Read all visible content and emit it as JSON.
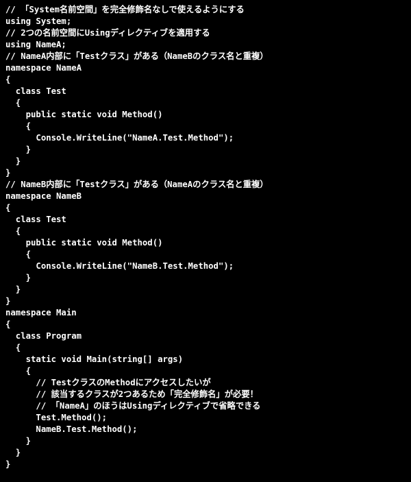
{
  "code": {
    "lines": [
      "// 「System名前空間」を完全修飾名なしで使えるようにする",
      "using System;",
      "",
      "// 2つの名前空間にUsingディレクティブを適用する",
      "using NameA;",
      "",
      "// NameA内部に「Testクラス」がある（NameBのクラス名と重複）",
      "namespace NameA",
      "{",
      "  class Test",
      "  {",
      "    public static void Method()",
      "    {",
      "      Console.WriteLine(\"NameA.Test.Method\");",
      "    }",
      "  }",
      "}",
      "",
      "// NameB内部に「Testクラス」がある（NameAのクラス名と重複）",
      "namespace NameB",
      "{",
      "  class Test",
      "  {",
      "    public static void Method()",
      "    {",
      "      Console.WriteLine(\"NameB.Test.Method\");",
      "    }",
      "  }",
      "}",
      "",
      "namespace Main",
      "{",
      "  class Program",
      "  {",
      "    static void Main(string[] args)",
      "    {",
      "      // TestクラスのMethodにアクセスしたいが",
      "      // 該当するクラスが2つあるため「完全修飾名」が必要！",
      "      // 「NameA」のほうはUsingディレクティブで省略できる",
      "      Test.Method();",
      "      NameB.Test.Method();",
      "    }",
      "  }",
      "}"
    ]
  }
}
